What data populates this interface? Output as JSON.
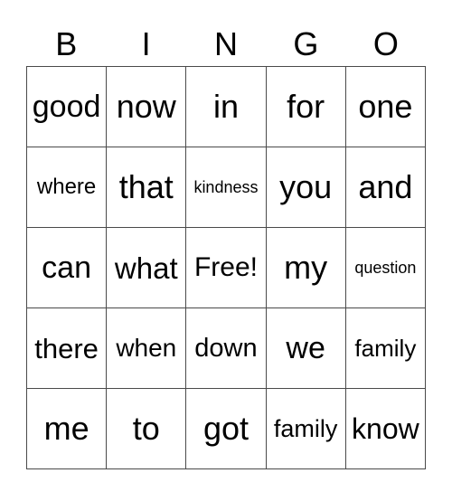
{
  "header": [
    "B",
    "I",
    "N",
    "G",
    "O"
  ],
  "rows": [
    [
      {
        "text": "good",
        "size": 34
      },
      {
        "text": "now",
        "size": 36
      },
      {
        "text": "in",
        "size": 36
      },
      {
        "text": "for",
        "size": 36
      },
      {
        "text": "one",
        "size": 36
      }
    ],
    [
      {
        "text": "where",
        "size": 24
      },
      {
        "text": "that",
        "size": 36
      },
      {
        "text": "kindness",
        "size": 18
      },
      {
        "text": "you",
        "size": 36
      },
      {
        "text": "and",
        "size": 36
      }
    ],
    [
      {
        "text": "can",
        "size": 34
      },
      {
        "text": "what",
        "size": 33
      },
      {
        "text": "Free!",
        "size": 30
      },
      {
        "text": "my",
        "size": 36
      },
      {
        "text": "question",
        "size": 18
      }
    ],
    [
      {
        "text": "there",
        "size": 31
      },
      {
        "text": "when",
        "size": 28
      },
      {
        "text": "down",
        "size": 29
      },
      {
        "text": "we",
        "size": 34
      },
      {
        "text": "family",
        "size": 26
      }
    ],
    [
      {
        "text": "me",
        "size": 36
      },
      {
        "text": "to",
        "size": 36
      },
      {
        "text": "got",
        "size": 36
      },
      {
        "text": "family",
        "size": 27
      },
      {
        "text": "know",
        "size": 32
      }
    ]
  ]
}
